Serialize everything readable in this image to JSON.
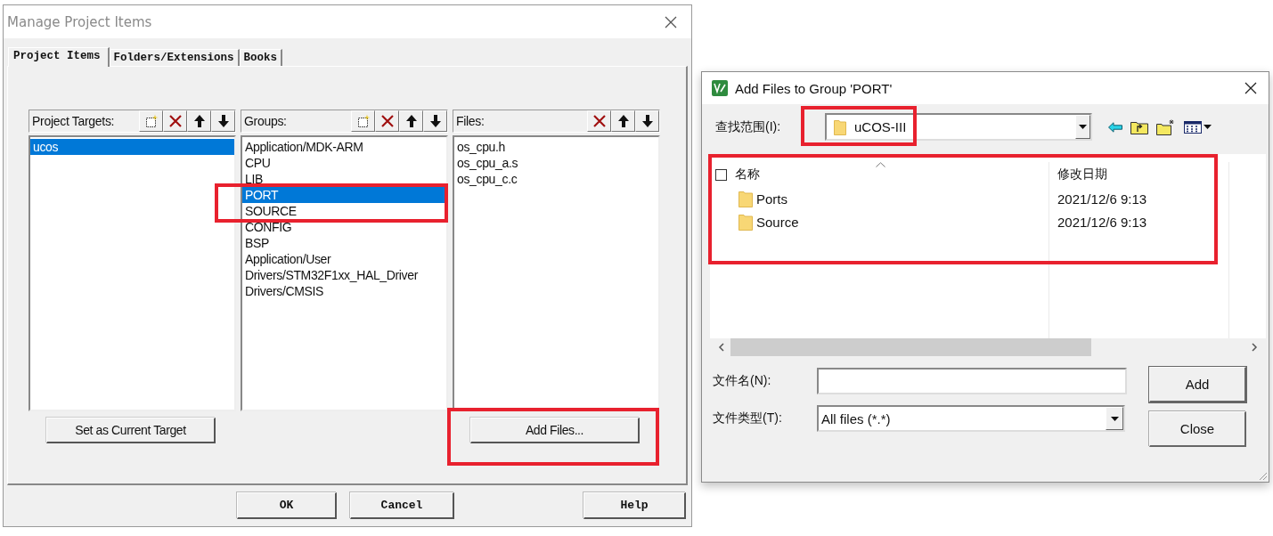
{
  "manage_dialog": {
    "title": "Manage Project Items",
    "tabs": [
      {
        "label": "Project Items",
        "selected": true
      },
      {
        "label": "Folders/Extensions",
        "selected": false
      },
      {
        "label": "Books",
        "selected": false
      }
    ],
    "panels": [
      {
        "kind": "targets",
        "label": "Project Targets:",
        "items": [
          {
            "label": "ucos",
            "selected": true
          }
        ]
      },
      {
        "kind": "groups",
        "label": "Groups:",
        "items": [
          {
            "label": "Application/MDK-ARM",
            "selected": false
          },
          {
            "label": "CPU",
            "selected": false
          },
          {
            "label": "LIB",
            "selected": false
          },
          {
            "label": "PORT",
            "selected": true
          },
          {
            "label": "SOURCE",
            "selected": false
          },
          {
            "label": "CONFIG",
            "selected": false
          },
          {
            "label": "BSP",
            "selected": false
          },
          {
            "label": "Application/User",
            "selected": false
          },
          {
            "label": "Drivers/STM32F1xx_HAL_Driver",
            "selected": false
          },
          {
            "label": "Drivers/CMSIS",
            "selected": false
          }
        ]
      },
      {
        "kind": "files",
        "label": "Files:",
        "items": [
          {
            "label": "os_cpu.h",
            "selected": false
          },
          {
            "label": "os_cpu_a.s",
            "selected": false
          },
          {
            "label": "os_cpu_c.c",
            "selected": false
          }
        ]
      }
    ],
    "set_target_button": "Set as Current Target",
    "add_files_button": "Add Files...",
    "buttons": [
      "OK",
      "Cancel",
      "Help"
    ]
  },
  "add_dialog": {
    "title": "Add Files to Group 'PORT'",
    "look_in": {
      "label": "查找范围(I):",
      "value": "uCOS-III"
    },
    "select_all": {
      "checked": false
    },
    "columns": [
      "名称",
      "修改日期"
    ],
    "rows": [
      {
        "name": "Ports",
        "modified": "2021/12/6 9:13"
      },
      {
        "name": "Source",
        "modified": "2021/12/6 9:13"
      }
    ],
    "file_name": {
      "label": "文件名(N):"
    },
    "file_type": {
      "label": "文件类型(T):",
      "value": "All files (*.*)"
    },
    "buttons": [
      "Add",
      "Close"
    ]
  }
}
